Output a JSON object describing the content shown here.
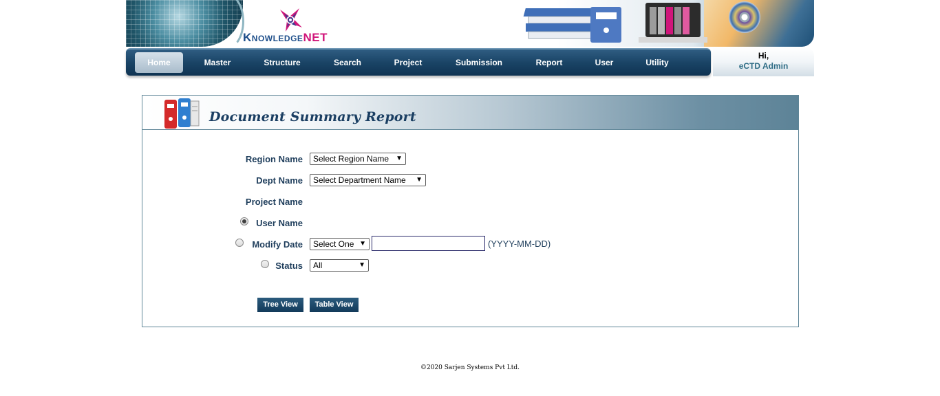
{
  "header": {
    "logo": {
      "word1": "Knowledge",
      "word2": "NET",
      "brand_colors": [
        "#1d4e8a",
        "#d0167a"
      ]
    },
    "greeting": {
      "hi": "Hi,",
      "user": "eCTD Admin"
    }
  },
  "nav": {
    "items": [
      {
        "label": "Home",
        "active": true
      },
      {
        "label": "Master"
      },
      {
        "label": "Structure"
      },
      {
        "label": "Search"
      },
      {
        "label": "Project"
      },
      {
        "label": "Submission"
      },
      {
        "label": "Report"
      },
      {
        "label": "User"
      },
      {
        "label": "Utility"
      }
    ],
    "colors": {
      "bar": "#1a4466",
      "active": "#a9bccb"
    }
  },
  "report": {
    "title": "Document Summary Report",
    "fields": {
      "region": {
        "label": "Region Name",
        "selected": "Select Region Name"
      },
      "dept": {
        "label": "Dept Name",
        "selected": "Select Department Name"
      },
      "project": {
        "label": "Project Name"
      },
      "user": {
        "label": "User Name",
        "checked": true
      },
      "modify_date": {
        "label": "Modify Date",
        "checked": false,
        "selected": "Select One",
        "value": "",
        "hint": "(YYYY-MM-DD)"
      },
      "status": {
        "label": "Status",
        "checked": false,
        "selected": "All"
      }
    },
    "buttons": {
      "tree": "Tree View",
      "table": "Table View"
    }
  },
  "footer": {
    "copyright": "©2020 Sarjen Systems Pvt Ltd."
  }
}
